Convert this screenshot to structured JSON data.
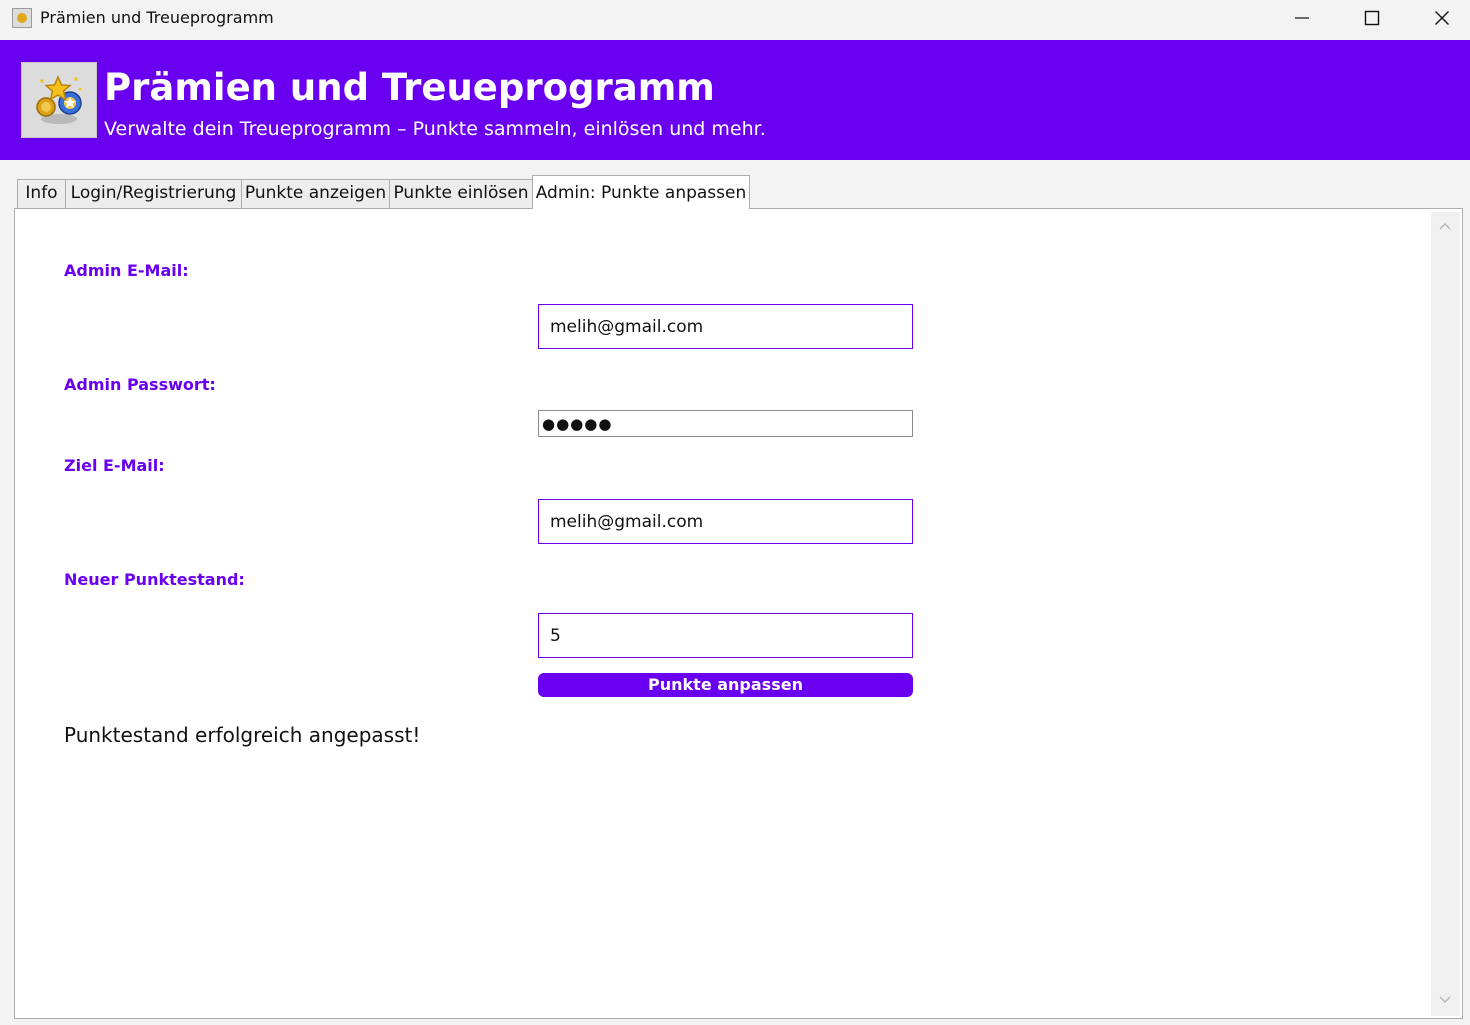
{
  "window": {
    "title": "Prämien und Treueprogramm"
  },
  "header": {
    "title": "Prämien und Treueprogramm",
    "subtitle": "Verwalte dein Treueprogramm – Punkte sammeln, einlösen und mehr."
  },
  "tabs": [
    {
      "label": "Info"
    },
    {
      "label": "Login/Registrierung"
    },
    {
      "label": "Punkte anzeigen"
    },
    {
      "label": "Punkte einlösen"
    },
    {
      "label": "Admin: Punkte anpassen",
      "active": true
    }
  ],
  "form": {
    "admin_email_label": "Admin E-Mail:",
    "admin_email_value": "melih@gmail.com",
    "admin_password_label": "Admin Passwort:",
    "admin_password_value": "●●●●●",
    "target_email_label": "Ziel E-Mail:",
    "target_email_value": "melih@gmail.com",
    "new_points_label": "Neuer Punktestand:",
    "new_points_value": "5",
    "submit_label": "Punkte anpassen"
  },
  "status_message": "Punktestand erfolgreich angepasst!",
  "colors": {
    "accent": "#6a00f0",
    "background": "#f3f3f3",
    "panel": "#ffffff"
  },
  "icons": {
    "app": "trophy-stars-icon",
    "minimize": "minimize-icon",
    "maximize": "maximize-icon",
    "close": "close-icon"
  }
}
